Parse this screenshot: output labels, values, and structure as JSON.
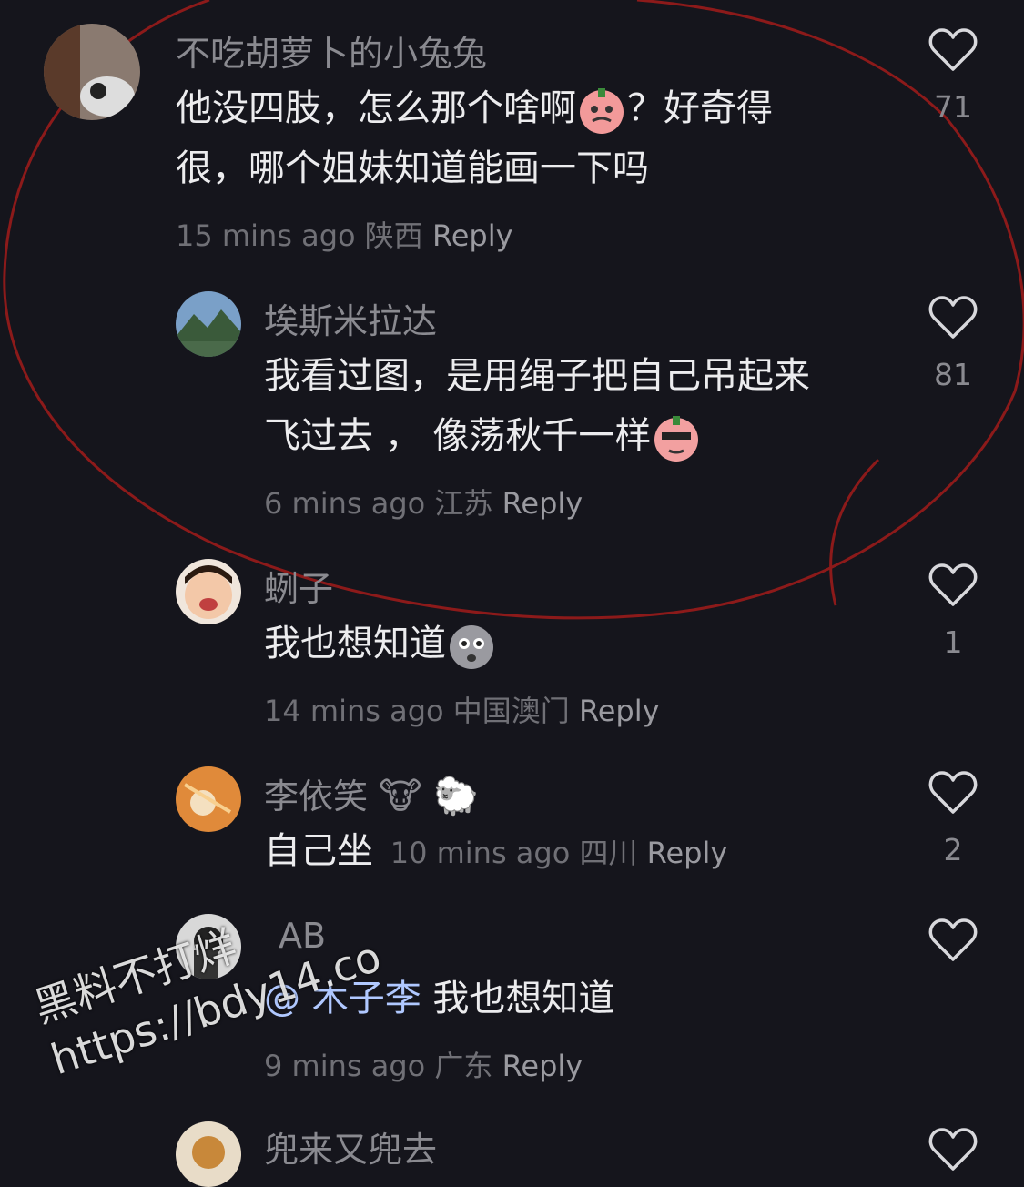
{
  "comments": [
    {
      "user": "不吃胡萝卜的小兔兔",
      "line1": "他没四肢，怎么那个啥啊",
      "line1b": "？好奇得",
      "line2": "很，哪个姐妹知道能画一下吗",
      "time": "15 mins ago",
      "region": "陕西",
      "reply": "Reply",
      "likes": "71"
    },
    {
      "user": "埃斯米拉达",
      "line1": "我看过图，是用绳子把自己吊起来",
      "line2": "飞过去 ， 像荡秋千一样",
      "time": "6 mins ago",
      "region": "江苏",
      "reply": "Reply",
      "likes": "81"
    },
    {
      "user": "蛚子",
      "line1": "我也想知道",
      "time": "14 mins ago",
      "region": "中国澳门",
      "reply": "Reply",
      "likes": "1"
    },
    {
      "user": "李依笑",
      "user_emoji": "🐮 🐑",
      "line1": "自己坐",
      "time": "10 mins ago",
      "region": "四川",
      "reply": "Reply",
      "likes": "2"
    },
    {
      "user": "AB",
      "mention": "@ 木子李",
      "line1": " 我也想知道",
      "time": "9 mins ago",
      "region": "广东",
      "reply": "Reply",
      "likes": ""
    },
    {
      "user": "兜来又兜去"
    }
  ],
  "watermark": {
    "line1": "黑料不打烊",
    "line2": "https://bdy14.co"
  },
  "colors": {
    "background": "#15151c",
    "annotation": "#8c1a1a"
  }
}
